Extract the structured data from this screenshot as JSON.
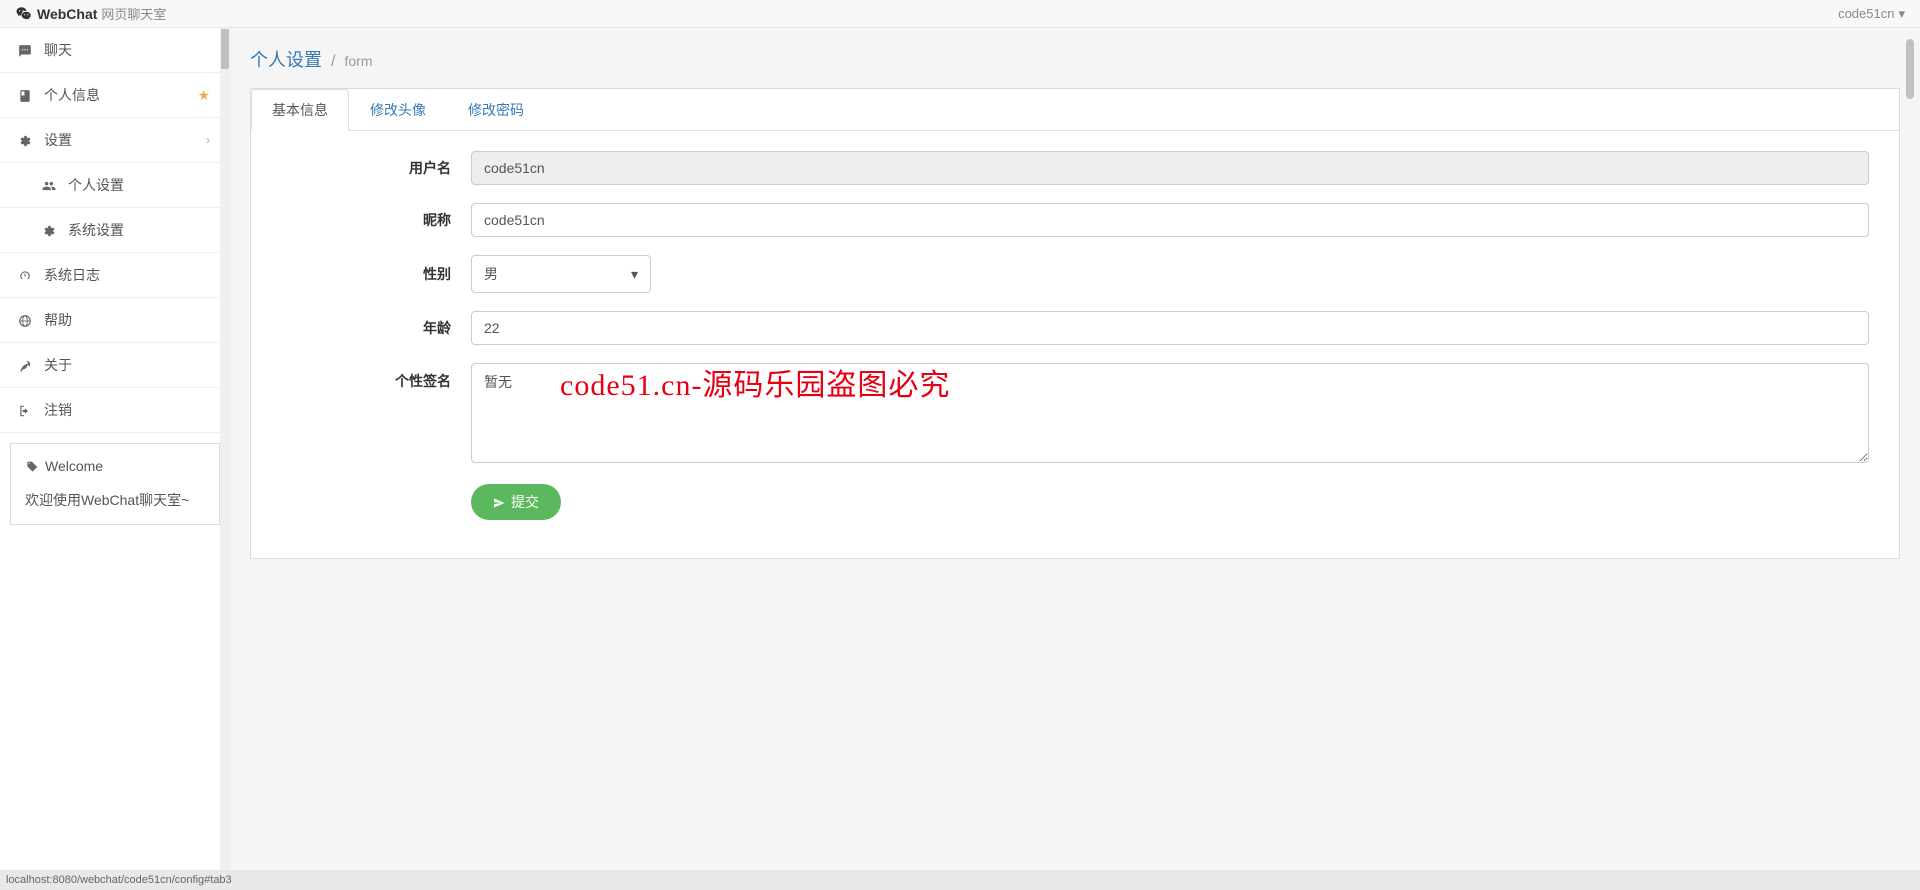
{
  "header": {
    "brand": "WebChat",
    "subtitle": "网页聊天室",
    "user": "code51cn"
  },
  "sidebar": {
    "items": [
      {
        "label": "聊天",
        "star": false
      },
      {
        "label": "个人信息",
        "star": true
      },
      {
        "label": "设置",
        "expandable": true
      }
    ],
    "subitems": [
      {
        "label": "个人设置"
      },
      {
        "label": "系统设置"
      }
    ],
    "items2": [
      {
        "label": "系统日志"
      },
      {
        "label": "帮助"
      },
      {
        "label": "关于"
      },
      {
        "label": "注销"
      }
    ],
    "welcome": {
      "title": "Welcome",
      "message": "欢迎使用WebChat聊天室~"
    }
  },
  "breadcrumb": {
    "title": "个人设置",
    "sub": "form"
  },
  "tabs": [
    {
      "label": "基本信息",
      "active": true
    },
    {
      "label": "修改头像",
      "active": false
    },
    {
      "label": "修改密码",
      "active": false
    }
  ],
  "form": {
    "username": {
      "label": "用户名",
      "value": "code51cn"
    },
    "nickname": {
      "label": "昵称",
      "value": "code51cn"
    },
    "gender": {
      "label": "性别",
      "value": "男"
    },
    "age": {
      "label": "年龄",
      "value": "22"
    },
    "signature": {
      "label": "个性签名",
      "value": "暂无"
    },
    "submit": "提交"
  },
  "watermark": "code51.cn-源码乐园盗图必究",
  "statusbar": "localhost:8080/webchat/code51cn/config#tab3"
}
